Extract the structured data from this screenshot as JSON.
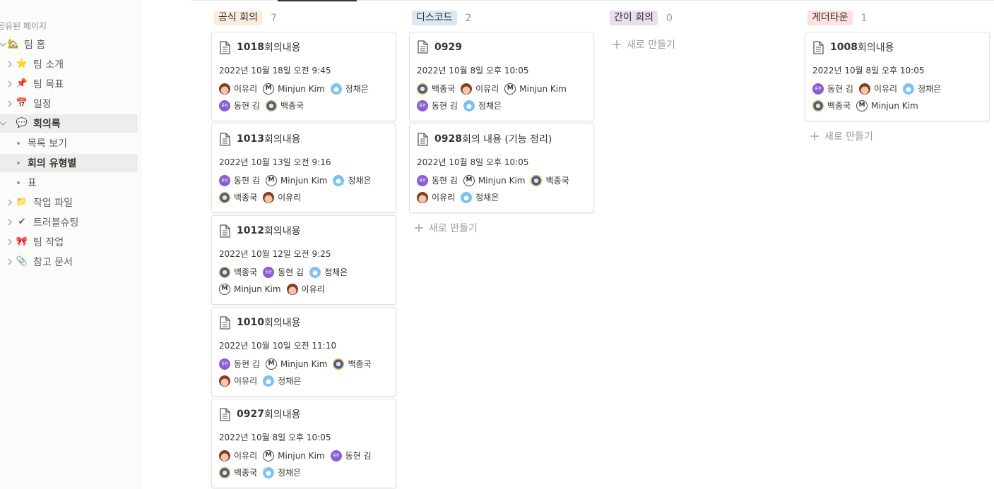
{
  "sidebar": {
    "section_label": "공유된 페이지",
    "items": [
      {
        "label": "팀 홈",
        "icon": "house-emoji",
        "glyph": "🏡"
      },
      {
        "label": "팀 소개",
        "icon": "star-emoji",
        "glyph": "⭐"
      },
      {
        "label": "팀 목표",
        "icon": "pushpin-emoji",
        "glyph": "📌"
      },
      {
        "label": "일정",
        "icon": "calendar-emoji",
        "glyph": "📅"
      },
      {
        "label": "회의록",
        "icon": "speech-bubble-emoji",
        "glyph": "💬"
      },
      {
        "label": "목록 보기"
      },
      {
        "label": "회의 유형별"
      },
      {
        "label": "표"
      },
      {
        "label": "작업 파일",
        "icon": "folder-emoji",
        "glyph": "📁"
      },
      {
        "label": "트러블슈팅",
        "icon": "check-mark-emoji",
        "glyph": "✔"
      },
      {
        "label": "팀 작업",
        "icon": "ribbon-emoji",
        "glyph": "🎀"
      },
      {
        "label": "참고 문서",
        "icon": "paperclip-emoji",
        "glyph": "📎"
      }
    ]
  },
  "board": {
    "new_label": "새로 만들기",
    "columns": [
      {
        "tag": "공식 회의",
        "count": "7",
        "color": "#fbecdd",
        "cards": [
          {
            "num": "1018",
            "rest": " 회의내용",
            "date": "2022년 10월 18일 오전 9:45",
            "row1": [
              {
                "name": "이유리",
                "avatar": "lee"
              },
              {
                "name": "Minjun Kim",
                "avatar": "m"
              },
              {
                "name": "정채은",
                "avatar": "jung"
              }
            ],
            "row2": [
              {
                "name": "동현 김",
                "avatar": "dong"
              },
              {
                "name": "백종국",
                "avatar": "baek"
              }
            ]
          },
          {
            "num": "1013",
            "rest": " 회의내용",
            "date": "2022년 10월 13일 오전 9:16",
            "row1": [
              {
                "name": "동현 김",
                "avatar": "dong"
              },
              {
                "name": "Minjun Kim",
                "avatar": "m"
              },
              {
                "name": "정채은",
                "avatar": "jung"
              }
            ],
            "row2": [
              {
                "name": "백종국",
                "avatar": "baek"
              },
              {
                "name": "이유리",
                "avatar": "lee"
              }
            ]
          },
          {
            "num": "1012",
            "rest": " 회의내용",
            "date": "2022년 10월 12일 오전 9:25",
            "row1": [
              {
                "name": "백종국",
                "avatar": "baek"
              },
              {
                "name": "동현 김",
                "avatar": "dong"
              },
              {
                "name": "정채은",
                "avatar": "jung"
              }
            ],
            "row2": [
              {
                "name": "Minjun Kim",
                "avatar": "m"
              },
              {
                "name": "이유리",
                "avatar": "lee"
              }
            ]
          },
          {
            "num": "1010",
            "rest": " 회의내용",
            "date": "2022년 10월 10일 오전 11:10",
            "row1": [
              {
                "name": "동현 김",
                "avatar": "dong"
              },
              {
                "name": "Minjun Kim",
                "avatar": "m"
              },
              {
                "name": "백종국",
                "avatar": "baek"
              }
            ],
            "row2": [
              {
                "name": "이유리",
                "avatar": "lee"
              },
              {
                "name": "정채은",
                "avatar": "jung"
              }
            ]
          },
          {
            "num": "0927",
            "rest": " 회의내용",
            "date": "2022년 10월 8일 오후 10:05",
            "row1": [
              {
                "name": "이유리",
                "avatar": "lee"
              },
              {
                "name": "Minjun Kim",
                "avatar": "m"
              },
              {
                "name": "동현 김",
                "avatar": "dong"
              }
            ],
            "row2": [
              {
                "name": "백종국",
                "avatar": "baek"
              },
              {
                "name": "정채은",
                "avatar": "jung"
              }
            ]
          }
        ]
      },
      {
        "tag": "디스코드",
        "count": "2",
        "color": "#dbe8f2",
        "cards": [
          {
            "num": "0929",
            "rest": "",
            "date": "2022년 10월 8일 오후 10:05",
            "row1": [
              {
                "name": "백종국",
                "avatar": "baek"
              },
              {
                "name": "이유리",
                "avatar": "lee"
              },
              {
                "name": "Minjun Kim",
                "avatar": "m"
              }
            ],
            "row2": [
              {
                "name": "동현 김",
                "avatar": "dong"
              },
              {
                "name": "정채은",
                "avatar": "jung"
              }
            ]
          },
          {
            "num": "0928",
            "rest": " 회의 내용 (기능 정리)",
            "date": "2022년 10월 8일 오후 10:05",
            "row1": [
              {
                "name": "동현 김",
                "avatar": "dong"
              },
              {
                "name": "Minjun Kim",
                "avatar": "m"
              },
              {
                "name": "백종국",
                "avatar": "baek"
              }
            ],
            "row2": [
              {
                "name": "이유리",
                "avatar": "lee"
              },
              {
                "name": "정채은",
                "avatar": "jung"
              }
            ]
          }
        ]
      },
      {
        "tag": "간이 회의",
        "count": "0",
        "color": "#e8deee",
        "cards": []
      },
      {
        "tag": "게더타운",
        "count": "1",
        "color": "#fde0e0",
        "cards": [
          {
            "num": "1008",
            "rest": " 회의내용",
            "date": "2022년 10월 8일 오후 10:05",
            "row1": [
              {
                "name": "동현 김",
                "avatar": "dong"
              },
              {
                "name": "이유리",
                "avatar": "lee"
              },
              {
                "name": "정채은",
                "avatar": "jung"
              }
            ],
            "row2": [
              {
                "name": "백종국",
                "avatar": "baek"
              },
              {
                "name": "Minjun Kim",
                "avatar": "m"
              }
            ]
          }
        ]
      }
    ]
  }
}
